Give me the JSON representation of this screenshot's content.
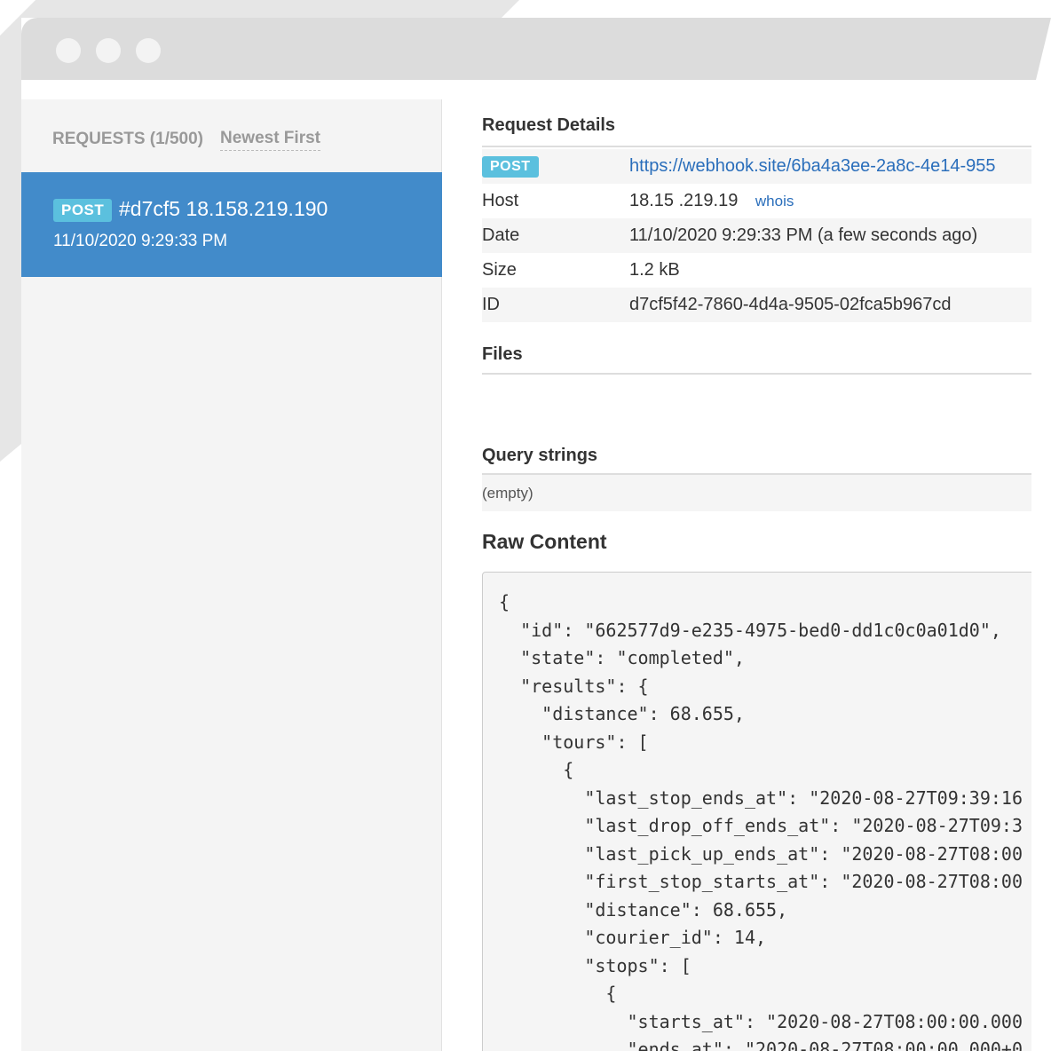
{
  "sidebar": {
    "heading": "REQUESTS (1/500)",
    "sort_label": "Newest First",
    "requests": [
      {
        "method": "POST",
        "title": "#d7cf5 18.158.219.190",
        "date": "11/10/2020 9:29:33 PM"
      }
    ]
  },
  "details": {
    "title": "Request Details",
    "method": "POST",
    "url": "https://webhook.site/6ba4a3ee-2a8c-4e14-955",
    "host_label": "Host",
    "host_value": "18.15 .219.19",
    "whois_label": "whois",
    "date_label": "Date",
    "date_value": "11/10/2020 9:29:33 PM (a few seconds ago)",
    "size_label": "Size",
    "size_value": "1.2 kB",
    "id_label": "ID",
    "id_value": "d7cf5f42-7860-4d4a-9505-02fca5b967cd"
  },
  "files": {
    "title": "Files"
  },
  "query": {
    "title": "Query strings",
    "empty_text": "(empty)"
  },
  "raw": {
    "title": "Raw Content",
    "body": "{\n  \"id\": \"662577d9-e235-4975-bed0-dd1c0c0a01d0\",\n  \"state\": \"completed\",\n  \"results\": {\n    \"distance\": 68.655,\n    \"tours\": [\n      {\n        \"last_stop_ends_at\": \"2020-08-27T09:39:16\n        \"last_drop_off_ends_at\": \"2020-08-27T09:3\n        \"last_pick_up_ends_at\": \"2020-08-27T08:00\n        \"first_stop_starts_at\": \"2020-08-27T08:00\n        \"distance\": 68.655,\n        \"courier_id\": 14,\n        \"stops\": [\n          {\n            \"starts_at\": \"2020-08-27T08:00:00.000\n            \"ends_at\": \"2020-08-27T08:00:00.000+0"
  }
}
